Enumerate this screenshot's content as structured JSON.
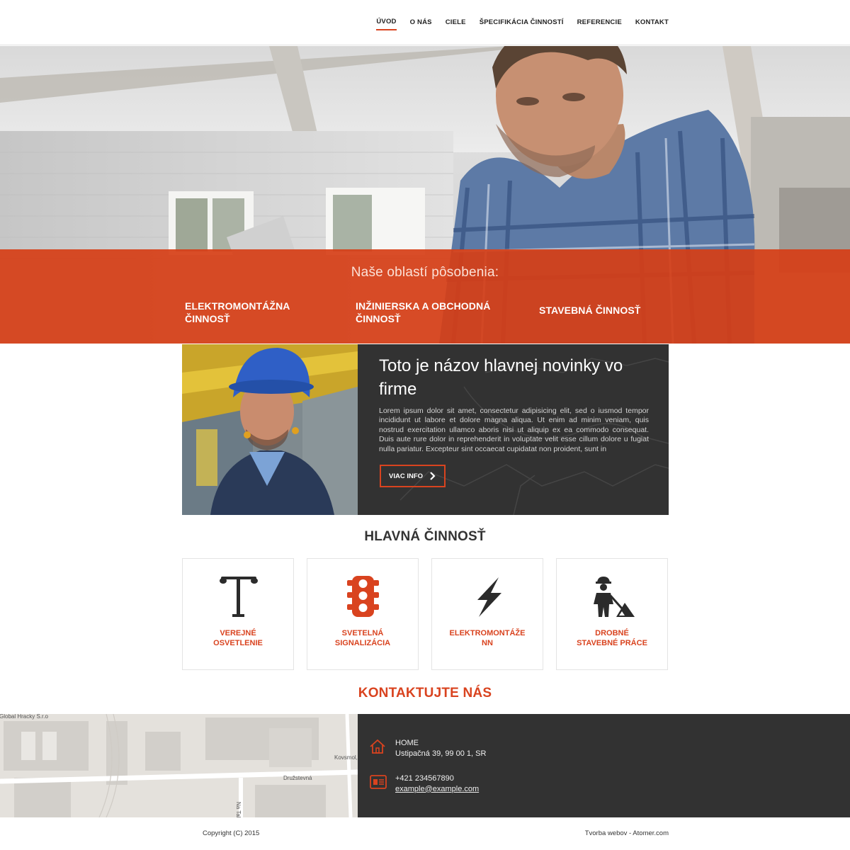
{
  "nav": {
    "items": [
      {
        "label": "ÚVOD",
        "active": true
      },
      {
        "label": "O NÁS"
      },
      {
        "label": "CIELE"
      },
      {
        "label": "ŠPECIFIKÁCIA ČINNOSTÍ"
      },
      {
        "label": "REFERENCIE"
      },
      {
        "label": "KONTAKT"
      }
    ]
  },
  "hero": {
    "band_title": "Naše oblastí pôsobenia:",
    "areas": [
      {
        "line1": "ELEKTROMONTÁŽNA",
        "line2": "ČINNOSŤ"
      },
      {
        "line1": "INŽINIERSKA A OBCHODNÁ",
        "line2": "ČINNOSŤ"
      },
      {
        "line1": "STAVEBNÁ ČINNOSŤ",
        "line2": ""
      }
    ]
  },
  "news": {
    "title": "Toto je názov hlavnej novinky vo firme",
    "text": "Lorem ipsum dolor sit amet, consectetur adipisicing elit, sed o iusmod tempor incididunt ut labore et dolore magna aliqua. Ut enim ad minim veniam, quis nostrud exercitation ullamco aboris nisi ut aliquip ex ea commodo consequat. Duis aute rure dolor in reprehenderit in voluptate velit esse cillum dolore u fugiat nulla pariatur. Excepteur sint occaecat cupidatat non proident, sunt in",
    "button": "VIAC INFO"
  },
  "main_activity": {
    "title": "HLAVNÁ ČINNOSŤ",
    "cards": [
      {
        "line1": "VEREJNÉ",
        "line2": "OSVETLENIE",
        "icon": "street-lamp-icon"
      },
      {
        "line1": "SVETELNÁ",
        "line2": "SIGNALIZÁCIA",
        "icon": "traffic-light-icon"
      },
      {
        "line1": "ELEKTROMONTÁŽE",
        "line2": "NN",
        "icon": "lightning-icon"
      },
      {
        "line1": "DROBNÉ",
        "line2": "STAVEBNÉ PRÁCE",
        "icon": "construction-worker-icon"
      }
    ]
  },
  "contact": {
    "title": "KONTAKTUJTE NÁS",
    "address_label": "HOME",
    "address": "Ustipačná 39, 99 00 1, SR",
    "phone": "+421 234567890",
    "email": "example@example.com",
    "map_labels": {
      "company": "Global Hracky S.r.o",
      "street1": "Družstevná",
      "street2": "Kovsmol,",
      "street3": "Na Tal"
    }
  },
  "colors": {
    "accent": "#d9431f",
    "dark": "#323232"
  },
  "footer": {
    "copyright": "Copyright (C) 2015",
    "credit": "Tvorba webov - Atomer.com"
  }
}
